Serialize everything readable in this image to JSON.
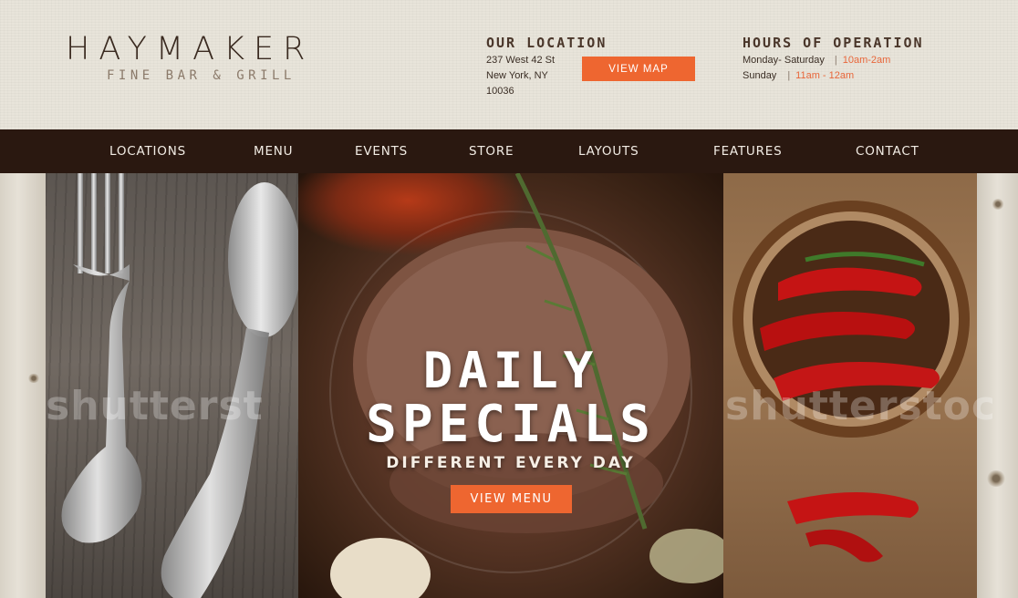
{
  "brand": {
    "name": "HAYMAKER",
    "tagline": "FINE BAR & GRILL"
  },
  "location": {
    "heading": "OUR LOCATION",
    "address_line1": "237 West 42 St",
    "address_line2": "New York, NY",
    "address_line3": "10036",
    "map_button": "VIEW MAP"
  },
  "hours": {
    "heading": "HOURS OF OPERATION",
    "rows": [
      {
        "days": "Monday- Saturday",
        "separator": "|",
        "time": "10am-2am"
      },
      {
        "days": "Sunday",
        "separator": "|",
        "time": "11am - 12am"
      }
    ]
  },
  "nav": {
    "items": [
      {
        "label": "LOCATIONS"
      },
      {
        "label": "MENU"
      },
      {
        "label": "EVENTS"
      },
      {
        "label": "STORE"
      },
      {
        "label": "LAYOUTS"
      },
      {
        "label": "FEATURES"
      },
      {
        "label": "CONTACT"
      }
    ]
  },
  "hero": {
    "title_line1": "DAILY",
    "title_line2": "SPECIALS",
    "subtitle": "DIFFERENT EVERY DAY",
    "menu_button": "VIEW MENU",
    "watermark_left": "shutterst",
    "watermark_right": "shutterstoc"
  },
  "colors": {
    "accent": "#ee6630",
    "nav_background": "#2a1810",
    "header_background": "#e8e4da",
    "hours_time": "#e8663a"
  }
}
